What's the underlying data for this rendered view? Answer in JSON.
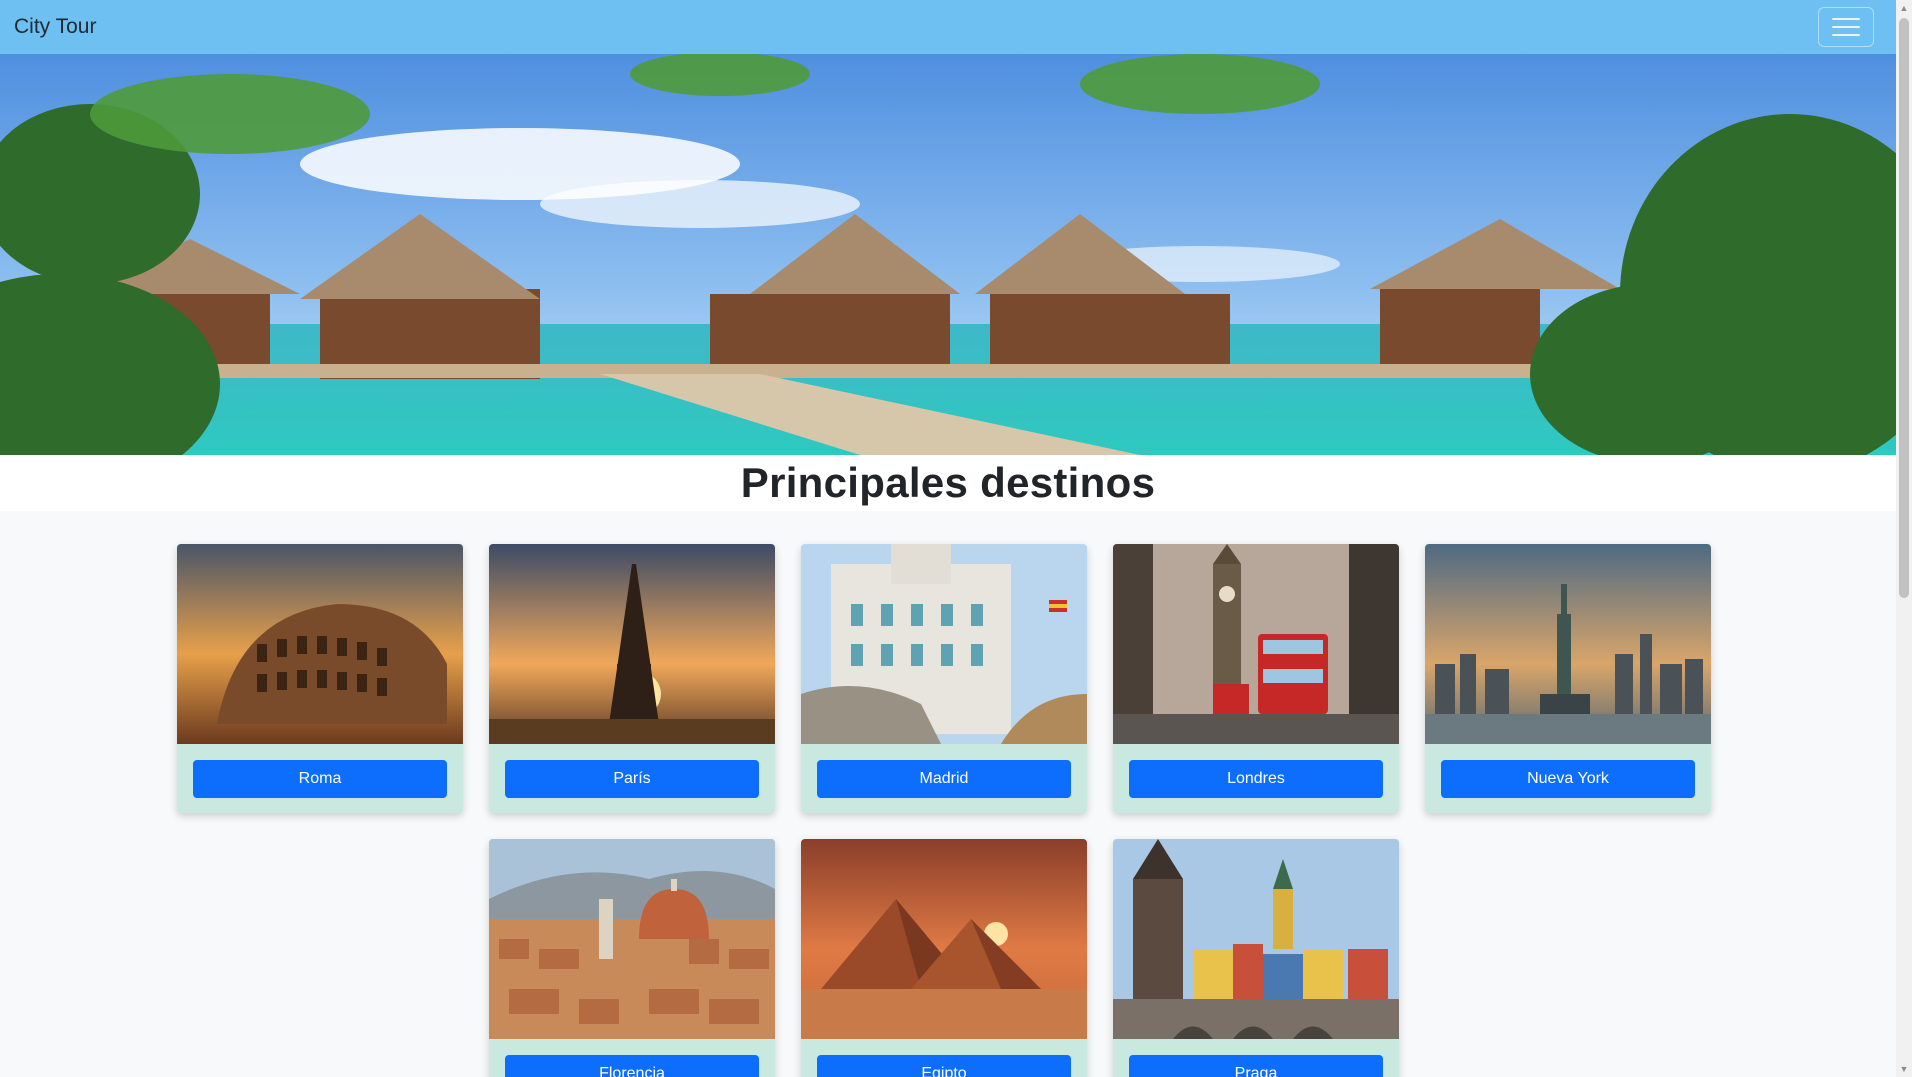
{
  "navbar": {
    "brand": "City Tour",
    "menu_icon": "hamburger-menu-icon"
  },
  "hero": {
    "image": "tropical-overwater-bungalows-photo"
  },
  "section": {
    "title": "Principales destinos"
  },
  "destinations": [
    {
      "label": "Roma",
      "image": "colosseum-photo"
    },
    {
      "label": "París",
      "image": "eiffel-tower-photo"
    },
    {
      "label": "Madrid",
      "image": "madrid-palace-photo"
    },
    {
      "label": "Londres",
      "image": "big-ben-bus-photo"
    },
    {
      "label": "Nueva York",
      "image": "statue-of-liberty-photo"
    },
    {
      "label": "Florencia",
      "image": "florence-cathedral-photo"
    },
    {
      "label": "Egipto",
      "image": "pyramids-photo"
    },
    {
      "label": "Praga",
      "image": "prague-bridge-photo"
    }
  ],
  "colors": {
    "navbar": "#6ec0f2",
    "card_body": "#c9e8df",
    "button": "#0d6efd",
    "page_bg": "#f8f9fa"
  }
}
